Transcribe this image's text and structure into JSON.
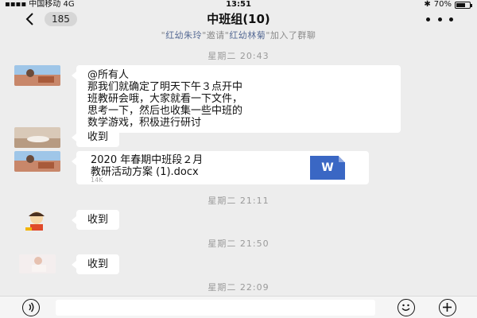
{
  "status": {
    "carrier": "中国移动",
    "network": "4G",
    "time": "13:51",
    "battery_text": "70%",
    "battery_level": 0.7
  },
  "nav": {
    "back_count": "185",
    "title": "中班组(10)"
  },
  "system_message": {
    "q1": "\"",
    "user1": "红幼朱玲",
    "q2": "\"邀请\"",
    "user2": "红幼林菊",
    "q3": "\"加入了群聊"
  },
  "messages": [
    {
      "timestamp": "星期二 20:43",
      "lines": [
        "@所有人",
        "那我们就确定了明天下午３点开中",
        "班教研会哦，大家就看一下文件，",
        "思考一下，然后也收集一些中班的",
        "数学游戏，积极进行研讨"
      ]
    },
    {
      "text": "收到"
    },
    {
      "file": {
        "name_line1": "2020 年春期中班段２月",
        "name_line2": "教研活动方案 (1).docx",
        "size": "14K",
        "icon_letter": "W"
      }
    },
    {
      "timestamp": "星期二 21:11",
      "text": "收到"
    },
    {
      "timestamp": "星期二 21:50",
      "text": "收到"
    },
    {
      "timestamp": "星期二 22:09"
    }
  ],
  "icons": {
    "voice": "voice-icon",
    "emoji": "emoji-icon",
    "plus": "plus-icon"
  }
}
